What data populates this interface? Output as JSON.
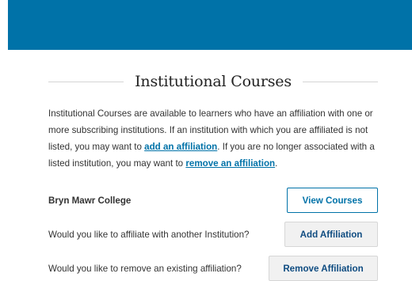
{
  "section": {
    "title": "Institutional Courses",
    "intro": {
      "part1": "Institutional Courses are available to learners who have an affiliation with one or more subscribing institutions. If an institution with which you are affiliated is not listed, you may want to ",
      "link_add": "add an affiliation",
      "part2": ". If you are no longer associated with a listed institution, you may want to ",
      "link_remove": "remove an affiliation",
      "part3": "."
    }
  },
  "rows": [
    {
      "label": "Bryn Mawr College",
      "button": "View Courses"
    },
    {
      "label": "Would you like to affiliate with another Institution?",
      "button": "Add Affiliation"
    },
    {
      "label": "Would you like to remove an existing affiliation?",
      "button": "Remove Affiliation"
    }
  ],
  "colors": {
    "banner": "#0072a8",
    "link": "#0072a8",
    "button_text": "#0f4c81"
  }
}
